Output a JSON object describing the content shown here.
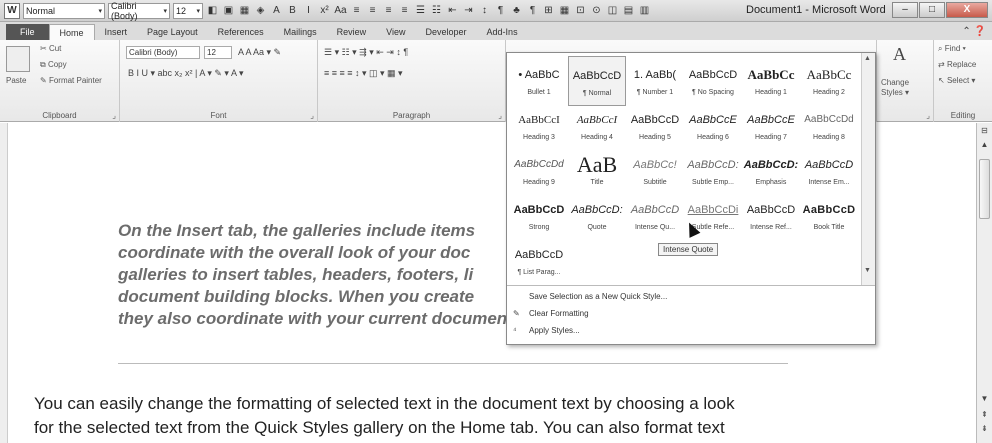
{
  "window": {
    "title": "Document1 - Microsoft Word",
    "app_icon": "W",
    "minimize": "–",
    "maximize": "□",
    "close": "X"
  },
  "quick_access": {
    "style_combo": "Normal",
    "font_combo": "Calibri (Body)",
    "size_combo": "12",
    "icons": [
      "◧",
      "▣",
      "▦",
      "◈",
      "A",
      "B",
      "I",
      "x²",
      "Aa",
      "≡",
      "≡",
      "≡",
      "≡",
      "☰",
      "☷",
      "⇤",
      "⇥",
      "↕",
      "¶",
      "♣",
      "¶",
      "⊞",
      "▦",
      "⊡",
      "⊙",
      "◫",
      "▤",
      "▥"
    ]
  },
  "tabs": [
    {
      "label": "File"
    },
    {
      "label": "Home"
    },
    {
      "label": "Insert"
    },
    {
      "label": "Page Layout"
    },
    {
      "label": "References"
    },
    {
      "label": "Mailings"
    },
    {
      "label": "Review"
    },
    {
      "label": "View"
    },
    {
      "label": "Developer"
    },
    {
      "label": "Add-Ins"
    }
  ],
  "tabs_right_icons": "⌃ ❓",
  "ribbon": {
    "clipboard": {
      "label": "Clipboard",
      "paste": "Paste",
      "cut": "Cut",
      "copy": "Copy",
      "format_painter": "Format Painter"
    },
    "font": {
      "label": "Font",
      "name": "Calibri (Body)",
      "size": "12",
      "row1_icons": "A A  Aa ▾  ✎",
      "row2_icons": "B  I  U ▾  abc  x₂  x²  |  A ▾  ✎ ▾  A ▾"
    },
    "paragraph": {
      "label": "Paragraph",
      "row1_icons": "☰ ▾ ☷ ▾ ⇶ ▾  ⇤ ⇥  ↕  ¶",
      "row2_icons": "≡  ≡  ≡  ≡  ↕ ▾  ◫ ▾  ▦ ▾"
    },
    "styles": {
      "change_styles": "Change Styles",
      "change_styles_line1": "Change",
      "change_styles_line2": "Styles ▾"
    },
    "editing": {
      "label": "Editing",
      "find": "Find ▾",
      "replace": "Replace",
      "select": "Select ▾"
    }
  },
  "gallery": {
    "rows": [
      [
        {
          "sample": "• AaBbC",
          "caption": "Bullet 1"
        },
        {
          "sample": "AaBbCcD",
          "caption": "¶ Normal",
          "selected": true
        },
        {
          "sample": "1. AaBb(",
          "caption": "¶ Number 1"
        },
        {
          "sample": "AaBbCcD",
          "caption": "¶ No Spacing"
        },
        {
          "sample": "AaBbCc",
          "caption": "Heading 1"
        },
        {
          "sample": "AaBbCc",
          "caption": "Heading 2"
        }
      ],
      [
        {
          "sample": "AaBbCcI",
          "caption": "Heading 3"
        },
        {
          "sample": "AaBbCcI",
          "caption": "Heading 4"
        },
        {
          "sample": "AaBbCcD",
          "caption": "Heading 5"
        },
        {
          "sample": "AaBbCcE",
          "caption": "Heading 6"
        },
        {
          "sample": "AaBbCcE",
          "caption": "Heading 7"
        },
        {
          "sample": "AaBbCcDd",
          "caption": "Heading 8"
        }
      ],
      [
        {
          "sample": "AaBbCcDd",
          "caption": "Heading 9"
        },
        {
          "sample": "AaB",
          "caption": "Title"
        },
        {
          "sample": "AaBbCc!",
          "caption": "Subtitle"
        },
        {
          "sample": "AaBbCcD:",
          "caption": "Subtle Emp..."
        },
        {
          "sample": "AaBbCcD:",
          "caption": "Emphasis"
        },
        {
          "sample": "AaBbCcD",
          "caption": "Intense Em..."
        }
      ],
      [
        {
          "sample": "AaBbCcD",
          "caption": "Strong"
        },
        {
          "sample": "AaBbCcD:",
          "caption": "Quote"
        },
        {
          "sample": "AaBbCcD",
          "caption": "Intense Qu..."
        },
        {
          "sample": "AaBbCcDi",
          "caption": "Subtle Refe..."
        },
        {
          "sample": "AaBbCcD",
          "caption": "Intense Ref..."
        },
        {
          "sample": "AaBbCcD",
          "caption": "Book Title"
        }
      ],
      [
        {
          "sample": "AaBbCcD",
          "caption": "¶ List Parag..."
        }
      ]
    ],
    "menu": [
      {
        "icon": "",
        "label": "Save Selection as a New Quick Style..."
      },
      {
        "icon": "✎",
        "label": "Clear Formatting"
      },
      {
        "icon": "⁴",
        "label": "Apply Styles..."
      }
    ],
    "tooltip": "Intense Quote"
  },
  "document": {
    "quote_text": "On the Insert tab, the galleries include items that are designed to coordinate with the overall look of your document. You can use these galleries to insert tables, headers, footers, lists, cover pages, and other document building blocks. When you create pictures, charts, or diagrams, they also coordinate with your current document look.",
    "quote_lines": [
      "On the Insert tab, the galleries include items",
      "coordinate with the overall look of your doc",
      "galleries to insert tables, headers, footers, li",
      "document building blocks. When you create",
      "they also coordinate with your current document look."
    ],
    "paragraph_lines": [
      "You can easily change the formatting of selected text in the document text by choosing a look",
      "for the selected text from the Quick Styles gallery on the Home tab. You can also format text"
    ]
  },
  "colors": {
    "quote": "#6c6c6c",
    "ribbon_bg": "#f0f0f0"
  }
}
